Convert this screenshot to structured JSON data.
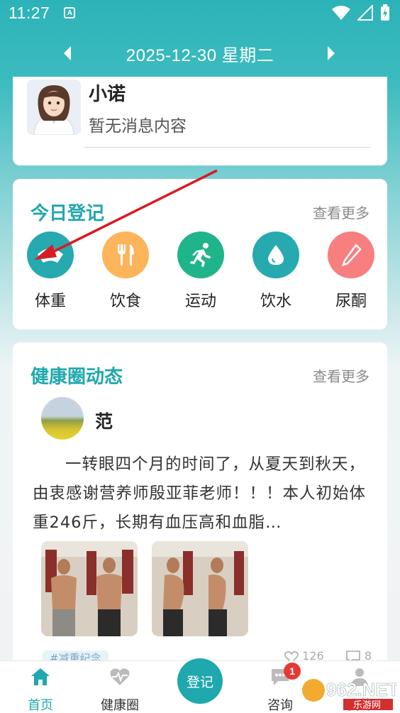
{
  "status_bar": {
    "time": "11:27",
    "app_icon_letter": "A",
    "icons": [
      "wifi-icon",
      "signal-icon",
      "battery-charging-icon"
    ]
  },
  "date_bar": {
    "date": "2025-12-30 星期二",
    "prev_icon": "chevron-left-icon",
    "next_icon": "chevron-right-icon"
  },
  "message": {
    "name": "小诺",
    "content": "暂无消息内容"
  },
  "today_record": {
    "title": "今日登记",
    "more": "查看更多",
    "items": [
      {
        "label": "体重",
        "icon": "scale-icon",
        "color": "#27a9b0"
      },
      {
        "label": "饮食",
        "icon": "fork-knife-icon",
        "color": "#fdb45a"
      },
      {
        "label": "运动",
        "icon": "running-icon",
        "color": "#20b48a"
      },
      {
        "label": "饮水",
        "icon": "water-drop-icon",
        "color": "#27a9b0"
      },
      {
        "label": "尿酮",
        "icon": "test-strip-icon",
        "color": "#f77f7f"
      }
    ]
  },
  "feed": {
    "title": "健康圈动态",
    "more": "查看更多",
    "post": {
      "user": "范",
      "text": "一转眼四个月的时间了，从夏天到秋天，由衷感谢营养师殷亚菲老师！！！本人初始体重246斤，长期有血压高和血脂…",
      "tag": "#减重纪念",
      "likes": "126",
      "comments": "8"
    }
  },
  "bottom_nav": {
    "items": [
      {
        "label": "首页",
        "icon": "home-icon"
      },
      {
        "label": "健康圈",
        "icon": "heart-pulse-icon"
      },
      {
        "label": "登记"
      },
      {
        "label": "咨询",
        "icon": "chat-icon",
        "badge": "1"
      },
      {
        "label": "我的",
        "icon": "user-icon"
      }
    ]
  },
  "watermark": {
    "text": "962.NET",
    "subtext": "乐游网"
  },
  "colors": {
    "accent": "#1fa8ad",
    "badge": "#e53935",
    "arrow": "#d91c24"
  }
}
